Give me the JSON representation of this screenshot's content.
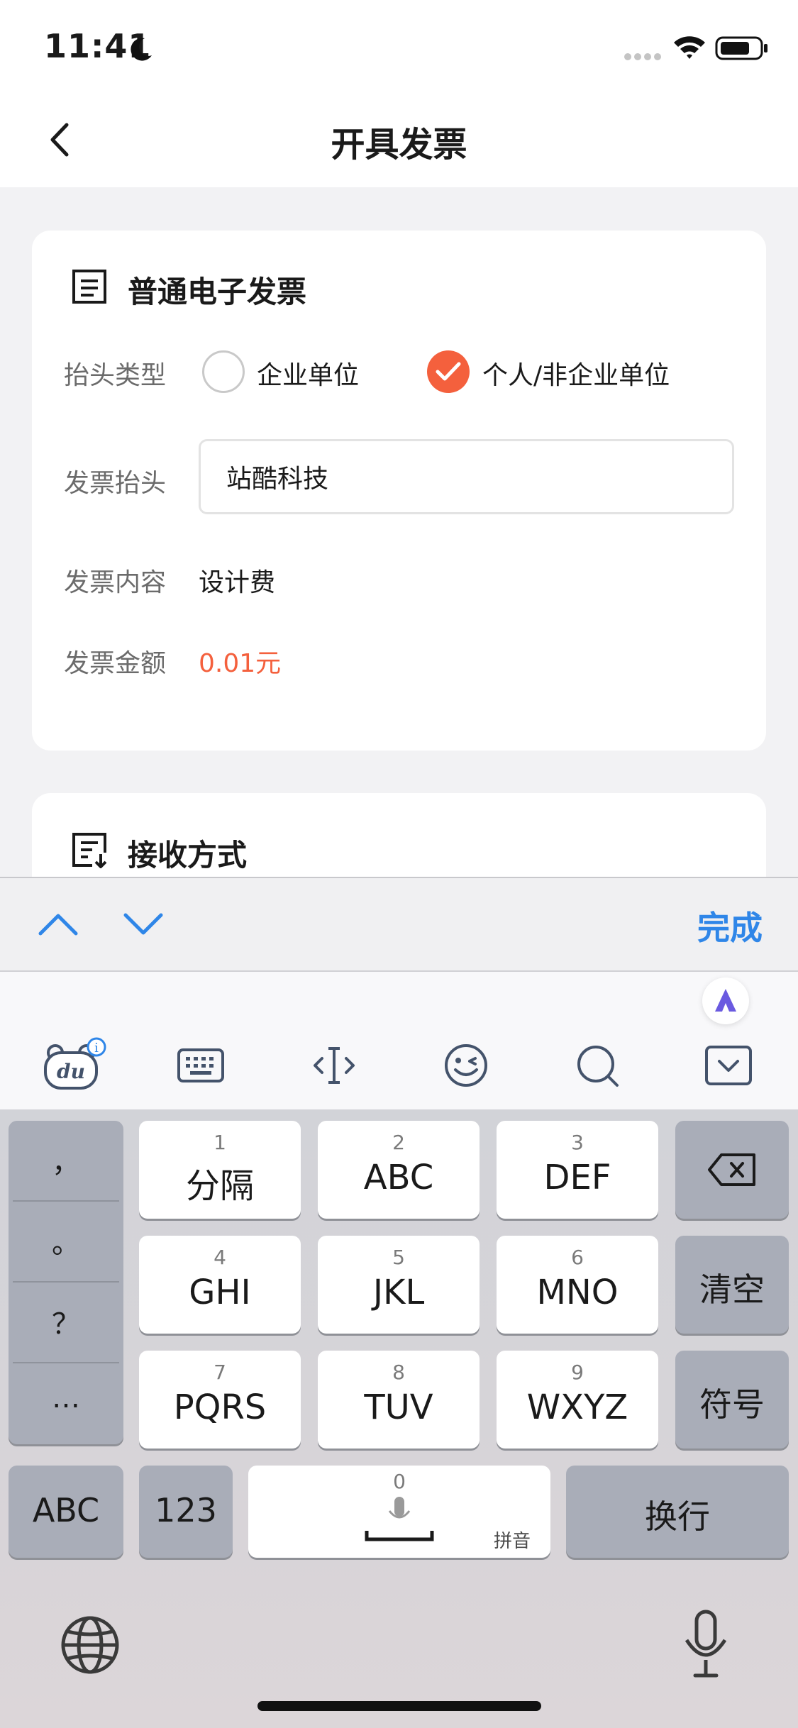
{
  "status_bar": {
    "time": "11:41"
  },
  "nav": {
    "title": "开具发票"
  },
  "invoice_card": {
    "title": "普通电子发票",
    "type_label": "抬头类型",
    "option_company": "企业单位",
    "option_personal": "个人/非企业单位",
    "selected_option": "个人/非企业单位",
    "invoice_title_label": "发票抬头",
    "invoice_title_value": "站酷科技",
    "content_label": "发票内容",
    "content_value": "设计费",
    "amount_label": "发票金额",
    "amount_value": "0.01元",
    "accent_color": "#f4603d"
  },
  "receive_card": {
    "title": "接收方式"
  },
  "keyboard_accessory": {
    "done_label": "完成",
    "accent_color": "#2f86e8"
  },
  "keyboard": {
    "punctuation": [
      "，",
      "。",
      "？",
      "…"
    ],
    "keys": [
      {
        "num": "1",
        "label": "分隔"
      },
      {
        "num": "2",
        "label": "ABC"
      },
      {
        "num": "3",
        "label": "DEF"
      },
      {
        "num": "4",
        "label": "GHI"
      },
      {
        "num": "5",
        "label": "JKL"
      },
      {
        "num": "6",
        "label": "MNO"
      },
      {
        "num": "7",
        "label": "PQRS"
      },
      {
        "num": "8",
        "label": "TUV"
      },
      {
        "num": "9",
        "label": "WXYZ"
      }
    ],
    "clear_label": "清空",
    "symbol_label": "符号",
    "abc_label": "ABC",
    "num_label": "123",
    "space_num": "0",
    "pinyin_label": "拼音",
    "return_label": "换行"
  }
}
